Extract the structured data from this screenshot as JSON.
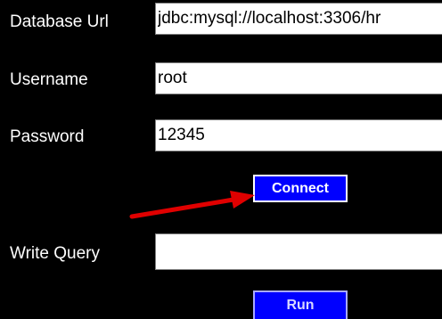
{
  "form": {
    "database_url": {
      "label": "Database Url",
      "value": "jdbc:mysql://localhost:3306/hr"
    },
    "username": {
      "label": "Username",
      "value": "root"
    },
    "password": {
      "label": "Password",
      "value": "12345"
    },
    "query": {
      "label": "Write Query",
      "value": ""
    }
  },
  "buttons": {
    "connect_label": "Connect",
    "run_label": "Run"
  },
  "annotation": {
    "arrow_color": "#e00000",
    "arrow_target": "connect-button"
  },
  "colors": {
    "background": "#000000",
    "button_fill": "#0000ff",
    "field_fill": "#ffffff"
  }
}
